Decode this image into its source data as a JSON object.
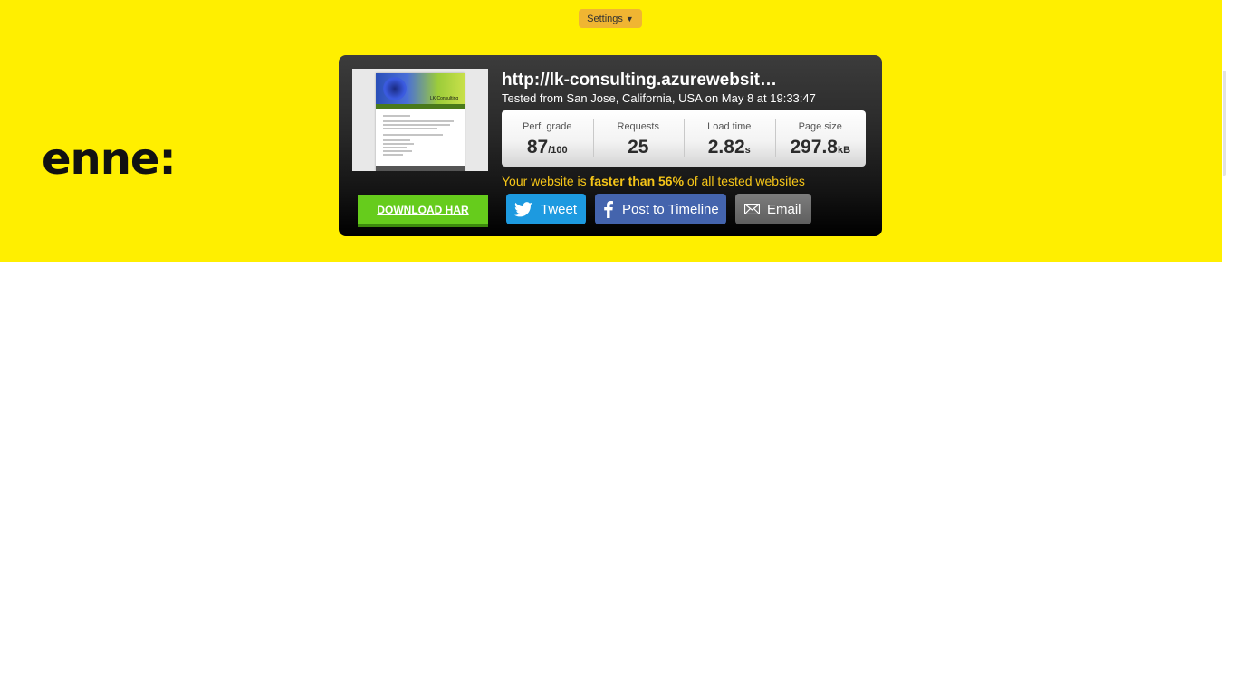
{
  "settings": {
    "label": "Settings",
    "caret": "▼"
  },
  "side_text": "enne:",
  "result": {
    "url": "http://lk-consulting.azurewebsit…",
    "tested": "Tested from San Jose, California, USA on May 8 at 19:33:47",
    "thumbnail_logo": "LK Consulting",
    "stats": [
      {
        "label": "Perf. grade",
        "value": "87",
        "unit": "/100"
      },
      {
        "label": "Requests",
        "value": "25",
        "unit": ""
      },
      {
        "label": "Load time",
        "value": "2.82",
        "unit": "s"
      },
      {
        "label": "Page size",
        "value": "297.8",
        "unit": "kB"
      }
    ],
    "faster": {
      "prefix": "Your website is ",
      "highlight": "faster than 56%",
      "suffix": " of all tested websites"
    }
  },
  "buttons": {
    "download": "DOWNLOAD HAR",
    "tweet": "Tweet",
    "facebook": "Post to Timeline",
    "email": "Email"
  },
  "icons": {
    "settings_caret": "chevron-down-icon",
    "tweet": "twitter-bird-icon",
    "facebook": "facebook-icon",
    "email": "envelope-icon"
  },
  "colors": {
    "banner": "#ffef00",
    "settings": "#f0b532",
    "download": "#66cc1c",
    "twitter": "#1d9ae0",
    "facebook": "#4464ad",
    "email": "#6e6e6e",
    "highlight_text": "#f5c518"
  }
}
